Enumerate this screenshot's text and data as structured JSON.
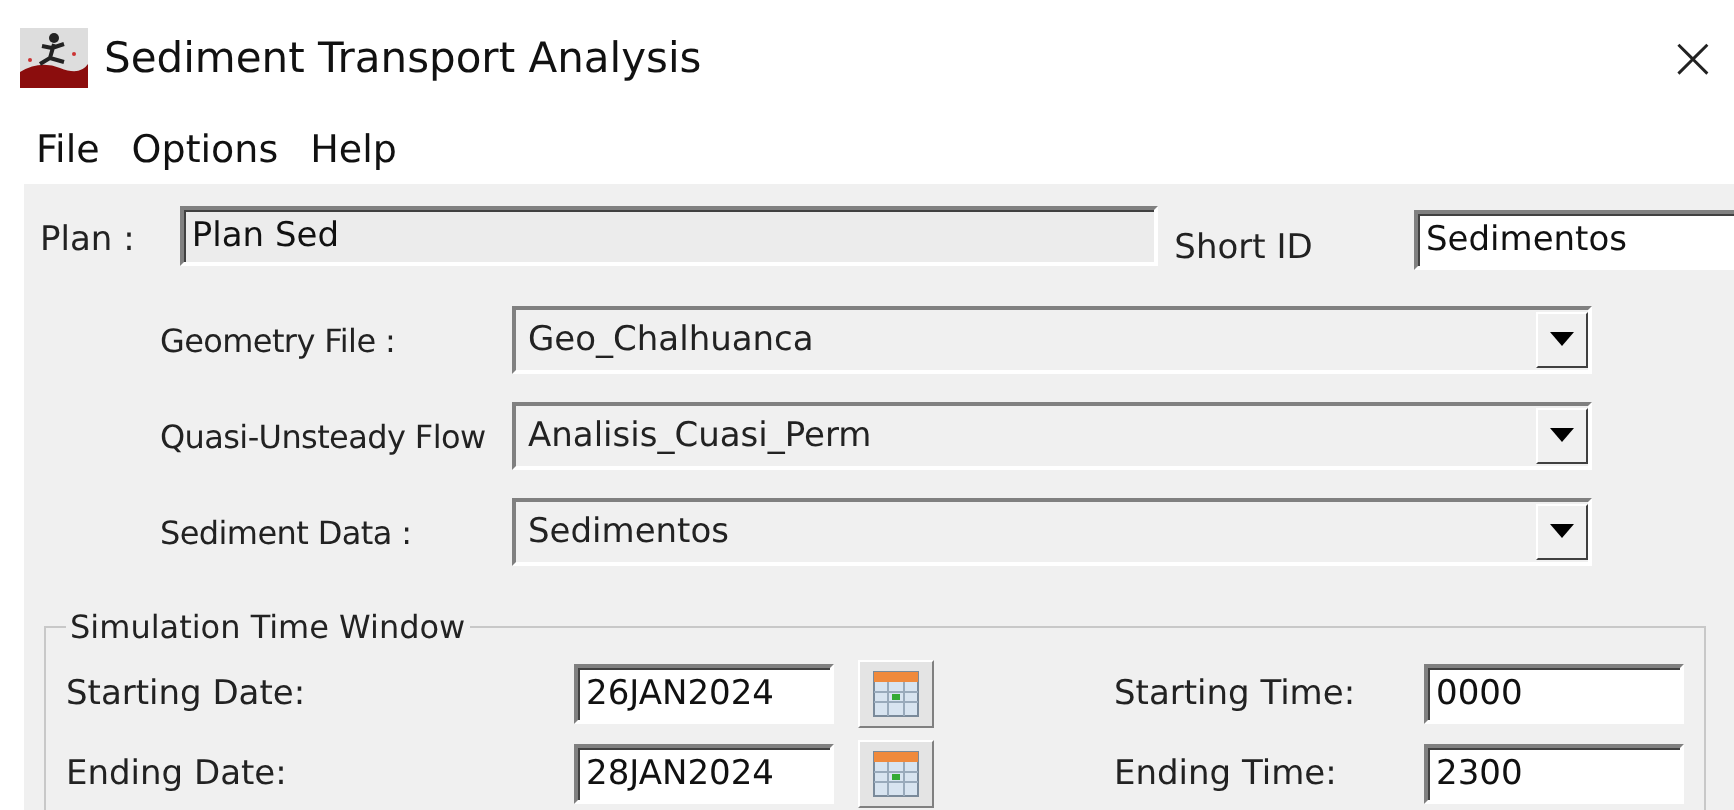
{
  "window": {
    "title": "Sediment Transport Analysis",
    "close": "×"
  },
  "menu": [
    "File",
    "Options",
    "Help"
  ],
  "plan": {
    "label": "Plan :",
    "value": "Plan Sed",
    "disabled": true
  },
  "short_id": {
    "label": "Short ID",
    "value": "Sedimentos"
  },
  "selectors": [
    {
      "label": "Geometry File :",
      "value": "Geo_Chalhuanca"
    },
    {
      "label": "Quasi-Unsteady Flow",
      "value": "Analisis_Cuasi_Perm"
    },
    {
      "label": "Sediment Data :",
      "value": "Sedimentos"
    }
  ],
  "time_window": {
    "title": "Simulation Time Window",
    "rows": [
      {
        "date_label": "Starting Date:",
        "date": "26JAN2024",
        "time_label": "Starting Time:",
        "time": "0000"
      },
      {
        "date_label": "Ending Date:",
        "date": "28JAN2024",
        "time_label": "Ending Time:",
        "time": "2300"
      }
    ]
  }
}
